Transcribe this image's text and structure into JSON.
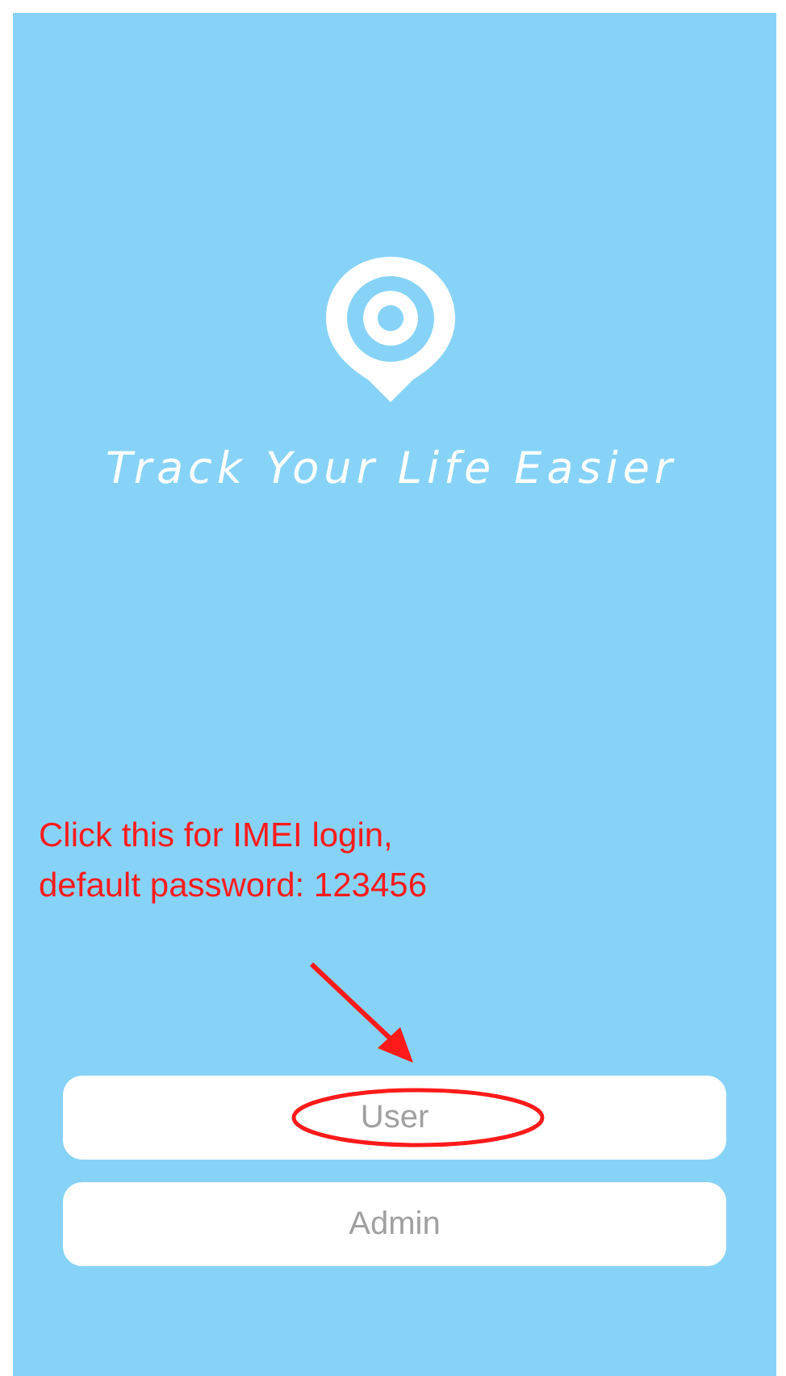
{
  "tagline": "Track Your Life Easier",
  "annotation": {
    "lines": [
      "Click this for IMEI login,",
      "default password:  123456"
    ]
  },
  "buttons": [
    {
      "label": "User",
      "highlighted": true
    },
    {
      "label": "Admin",
      "highlighted": false
    }
  ]
}
